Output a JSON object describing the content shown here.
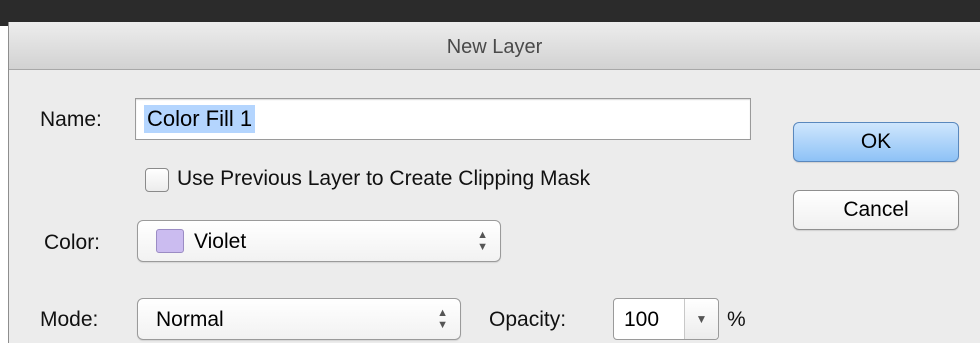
{
  "window": {
    "title": "New Layer"
  },
  "name": {
    "label": "Name:",
    "value": "Color Fill 1"
  },
  "buttons": {
    "ok": "OK",
    "cancel": "Cancel"
  },
  "clipping": {
    "label": "Use Previous Layer to Create Clipping Mask",
    "checked": false
  },
  "color": {
    "label": "Color:",
    "value": "Violet",
    "swatch": "#cbbcf0"
  },
  "mode": {
    "label": "Mode:",
    "value": "Normal"
  },
  "opacity": {
    "label": "Opacity:",
    "value": "100",
    "unit": "%"
  },
  "icons": {
    "popup_arrows": "up-down-arrows-icon",
    "dropdown": "triangle-down-icon"
  }
}
